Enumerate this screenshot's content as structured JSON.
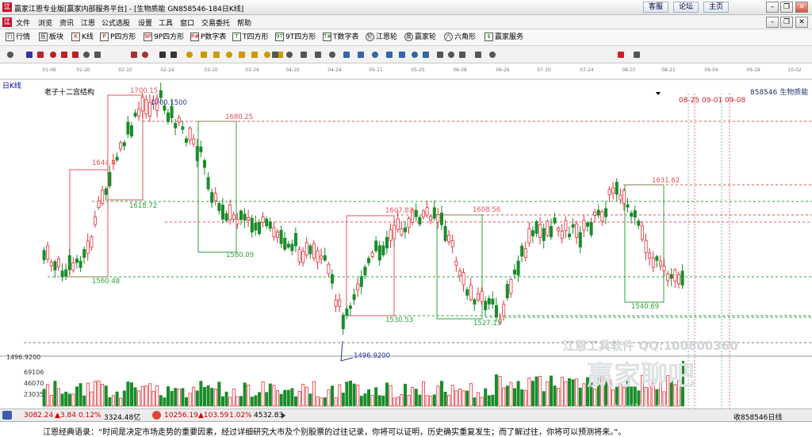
{
  "window": {
    "title": "赢家江恩专业版[赢家内部服务平台] - [生物质能  GN858546-184日K线]",
    "buttons": {
      "service": "客服",
      "forum": "论坛",
      "home": "主页"
    },
    "controls": {
      "minimize": "–",
      "restore": "❐",
      "close": "✕"
    }
  },
  "menubar": {
    "logo": "江",
    "items": [
      "文件",
      "浏览",
      "资讯",
      "江恩",
      "公式选股",
      "设置",
      "工具",
      "窗口",
      "交易委托",
      "帮助"
    ],
    "controls": {
      "minimize": "–",
      "restore": "❐",
      "close": "✕"
    }
  },
  "toolbar1": {
    "items": [
      "行情",
      "板块",
      "K线",
      "P四方形",
      "9P四方形",
      "P数字表",
      "T四方形",
      "9T四方形",
      "T数字表",
      "江恩轮",
      "赢家轮",
      "六角形",
      "赢家服务"
    ],
    "icons": [
      "行",
      "板",
      "K",
      "P",
      "9P",
      "P#",
      "T",
      "9T",
      "T#",
      "轮",
      "赢",
      "六",
      "$"
    ]
  },
  "chart": {
    "period_label": "日K线",
    "indicator_label": "老子十二宫结构",
    "code_label": "858546 生物质能",
    "date_ticks": [
      "01-06",
      "01-20",
      "02-10",
      "02-24",
      "03-10",
      "03-24",
      "04-10",
      "04-24",
      "05-11",
      "05-25",
      "06-08",
      "06-26",
      "07-10",
      "07-24",
      "08-07",
      "08-21",
      "09-04",
      "09-18",
      "10-02"
    ],
    "future_dates": "08-25 09-01 09-08",
    "price_labels": [
      "1700.15",
      "1700.1500",
      "1680.25",
      "1644.4",
      "1618.72",
      "1580.09",
      "1560.48",
      "1631.62",
      "1607.83",
      "1608.56",
      "1530.53",
      "1527.13",
      "1540.69",
      "1496.9200"
    ],
    "axis_price": "1496.9200",
    "volume_ticks": [
      "69106",
      "46070",
      "23035"
    ],
    "watermark1": "江恩工具软件  QQ:100800360",
    "watermark2": "赢家聊吧",
    "watermark3": "liaoba.yj365.com"
  },
  "colors": {
    "up": "#e0303a",
    "down": "#1a8c2a",
    "box_red": "#e8505a",
    "box_green": "#2fa33a",
    "accent": "#c8102e"
  },
  "statusbar": {
    "sh_index": "3082.24",
    "sh_change": "▲3.84",
    "sh_pct": "0.12%",
    "sh_amount": "3324.48亿",
    "sz_index": "10256.19",
    "sz_change": "▲103.59",
    "sz_pct": "1.02%",
    "sz_amount": "4532.83",
    "right_text": "收858546日线"
  },
  "ticker": {
    "text": "江恩经典语录：“时间是决定市场走势的重要因素，经过详细研究大市及个别股票的过往记录，你将可以证明，历史确实重复发生；而了解过往，你将可以预测将来。”。"
  }
}
